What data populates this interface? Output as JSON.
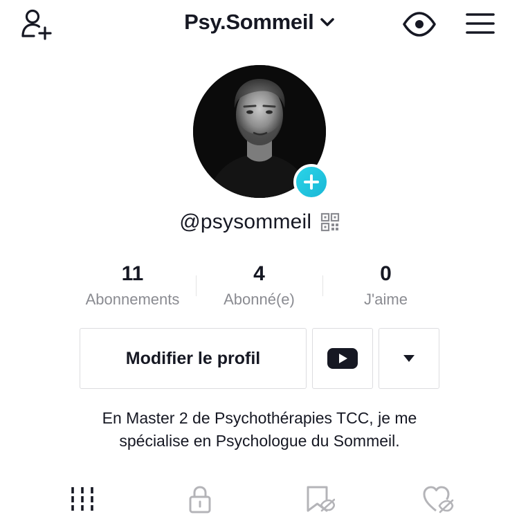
{
  "header": {
    "account_name": "Psy.Sommeil",
    "icons": {
      "add_user": "add-user-icon",
      "chevron": "chevron-down-icon",
      "privacy": "eye-icon",
      "menu": "hamburger-menu-icon"
    }
  },
  "profile": {
    "handle": "@psysommeil",
    "avatar_badge": "plus-icon",
    "accent_color": "#20c4e0"
  },
  "stats": [
    {
      "value": "11",
      "label": "Abonnements"
    },
    {
      "value": "4",
      "label": "Abonné(e)"
    },
    {
      "value": "0",
      "label": "J'aime"
    }
  ],
  "actions": {
    "edit_profile_label": "Modifier le profil",
    "youtube_icon": "youtube-icon",
    "more_icon": "caret-down-icon"
  },
  "bio": {
    "line1": "En Master 2 de Psychothérapies TCC, je me",
    "line2": "spécialise en Psychologue du Sommeil."
  },
  "tabs": [
    {
      "icon": "grid-icon",
      "active": true
    },
    {
      "icon": "lock-icon",
      "active": false
    },
    {
      "icon": "bookmark-hidden-icon",
      "active": false
    },
    {
      "icon": "heart-hidden-icon",
      "active": false
    }
  ]
}
